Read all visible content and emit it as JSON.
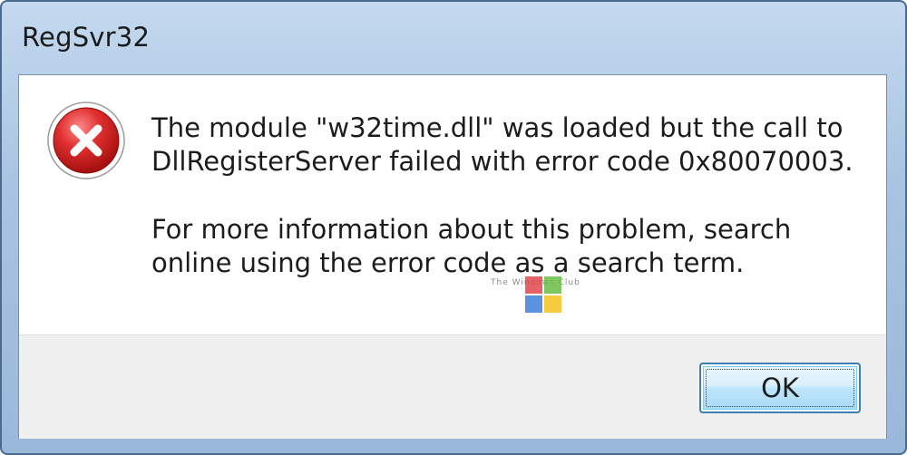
{
  "window": {
    "title": "RegSvr32"
  },
  "dialog": {
    "icon": "error-icon",
    "message_line1": "The module \"w32time.dll\" was loaded but the call to DllRegisterServer failed with error code 0x80070003.",
    "message_line2": "For more information about this problem, search online using the error code as a search term."
  },
  "buttons": {
    "ok_label": "OK"
  },
  "watermark": {
    "text": "The Windows Club"
  },
  "colors": {
    "title_bar": "#a9c4e2",
    "error_red": "#d42323",
    "button_border": "#3c7fb1"
  }
}
